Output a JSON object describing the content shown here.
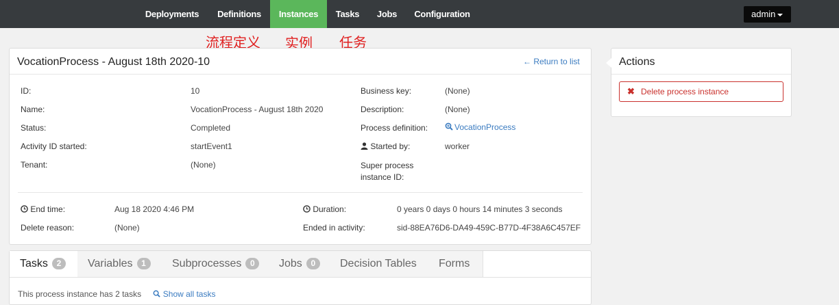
{
  "nav": {
    "items": [
      {
        "label": "Deployments",
        "active": false
      },
      {
        "label": "Definitions",
        "active": false
      },
      {
        "label": "Instances",
        "active": true
      },
      {
        "label": "Tasks",
        "active": false
      },
      {
        "label": "Jobs",
        "active": false
      },
      {
        "label": "Configuration",
        "active": false
      }
    ],
    "user_label": "admin"
  },
  "annotations": [
    "流程定义",
    "实例",
    "任务"
  ],
  "instance": {
    "title": "VocationProcess - August 18th 2020-10",
    "return_link": "← Return to list",
    "fields_left": [
      {
        "label": "ID:",
        "value": "10"
      },
      {
        "label": "Name:",
        "value": "VocationProcess - August 18th 2020"
      },
      {
        "label": "Status:",
        "value": "Completed"
      },
      {
        "label": "Activity ID started:",
        "value": "startEvent1"
      },
      {
        "label": "Tenant:",
        "value": "(None)"
      }
    ],
    "fields_right": [
      {
        "label": "Business key:",
        "value": "(None)"
      },
      {
        "label": "Description:",
        "value": "(None)"
      },
      {
        "label": "Process definition:",
        "value": "VocationProcess"
      },
      {
        "label": "Started by:",
        "value": "worker"
      },
      {
        "label": "Super process instance ID:",
        "value": ""
      }
    ],
    "end_time_label": "End time:",
    "end_time_value": "Aug 18 2020 4:46 PM",
    "delete_reason_label": "Delete reason:",
    "delete_reason_value": "(None)",
    "duration_label": "Duration:",
    "duration_value": "0 years 0 days 0 hours 14 minutes 3 seconds",
    "ended_activity_label": "Ended in activity:",
    "ended_activity_value": "sid-88EA76D6-DA49-459C-B77D-4F38A6C457EF"
  },
  "actions": {
    "title": "Actions",
    "delete_label": "Delete process instance"
  },
  "tabs": [
    {
      "label": "Tasks",
      "count": "2",
      "active": true
    },
    {
      "label": "Variables",
      "count": "1",
      "active": false
    },
    {
      "label": "Subprocesses",
      "count": "0",
      "active": false
    },
    {
      "label": "Jobs",
      "count": "0",
      "active": false
    },
    {
      "label": "Decision Tables",
      "count": null,
      "active": false
    },
    {
      "label": "Forms",
      "count": null,
      "active": false
    }
  ],
  "tab_content": {
    "text": "This process instance has 2 tasks",
    "show_all": "Show all tasks"
  },
  "colors": {
    "topbar": "#373b3e",
    "active_nav": "#5bb75b",
    "link": "#3a7bc0",
    "danger": "#c9302c",
    "annotation": "#e02020"
  }
}
